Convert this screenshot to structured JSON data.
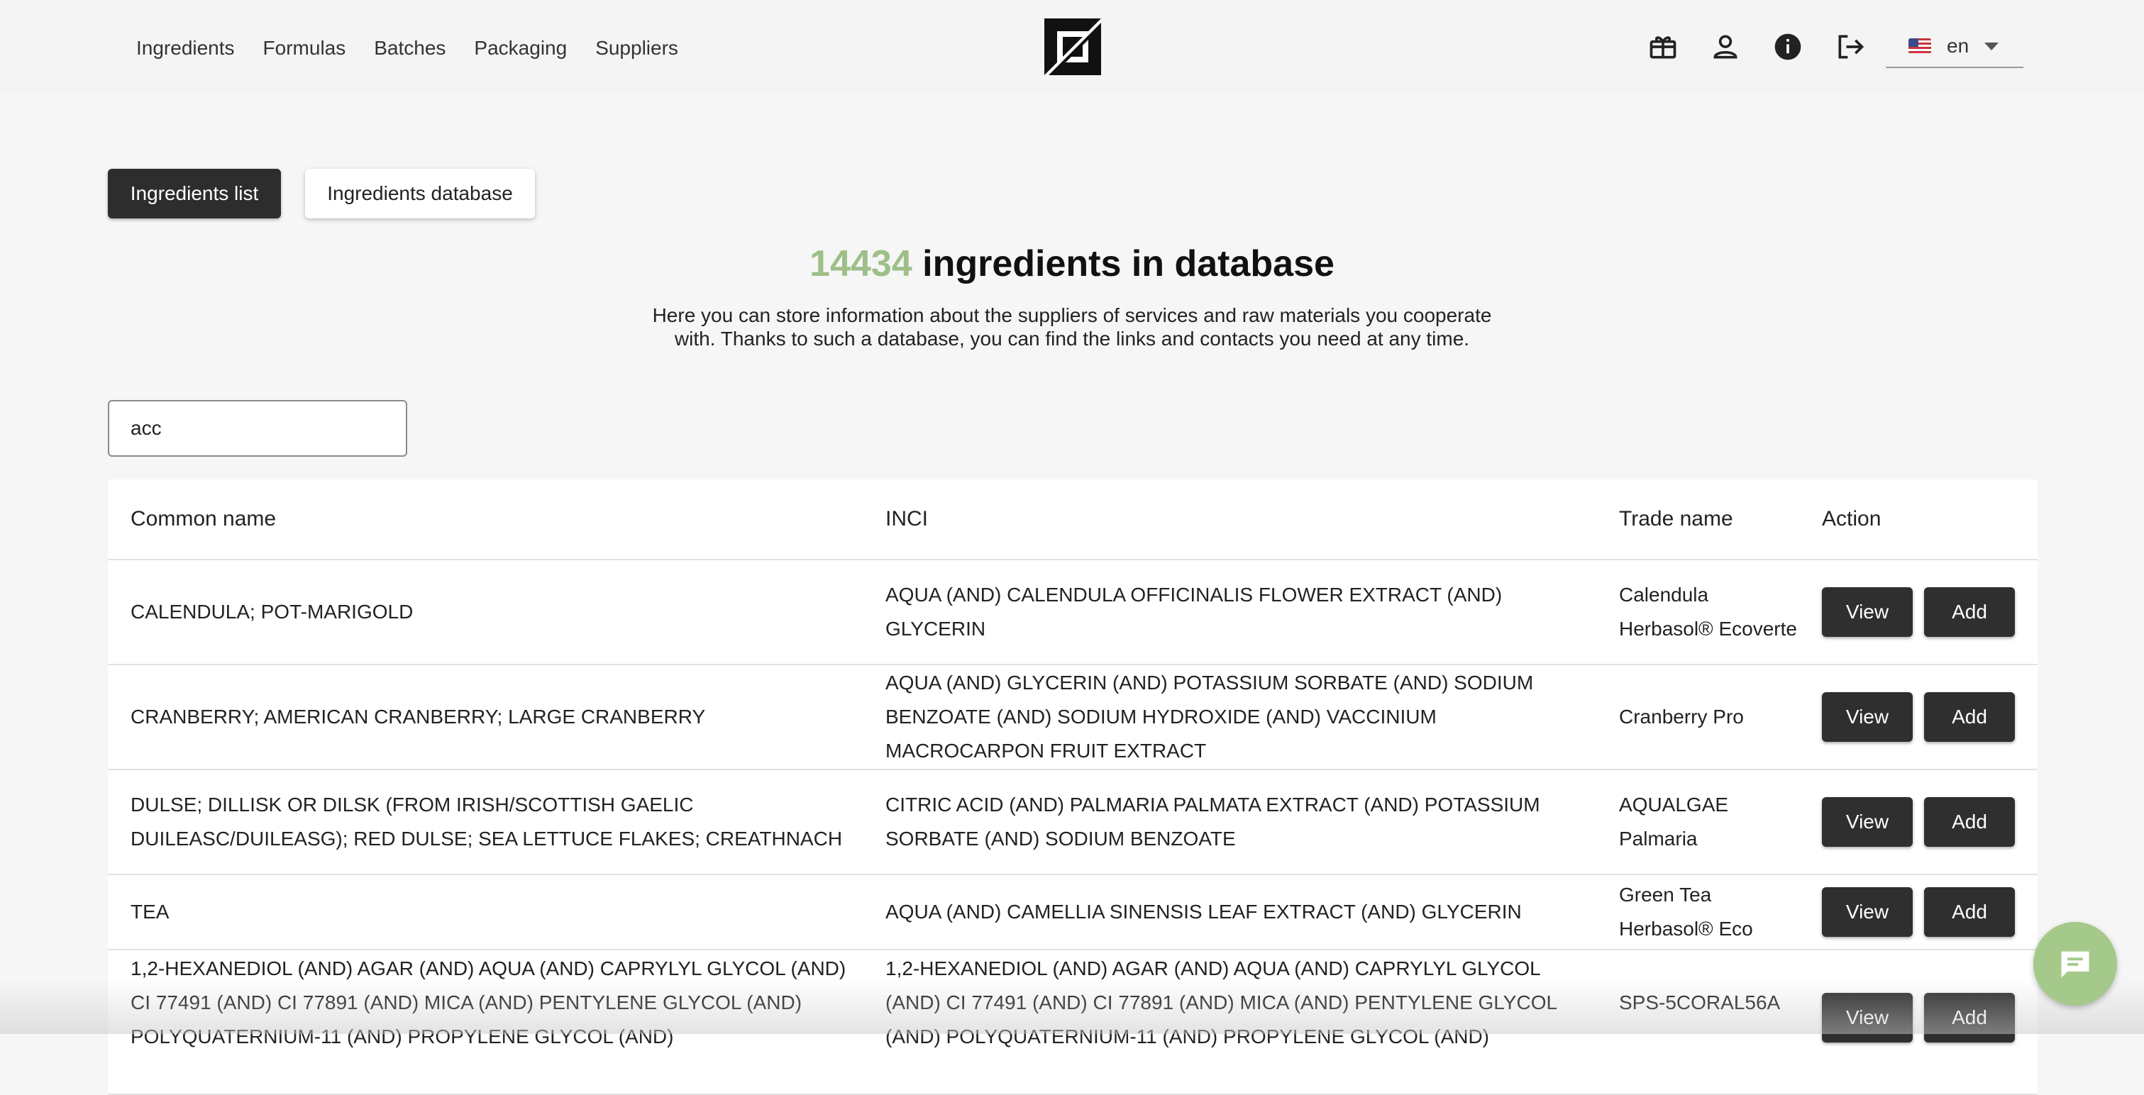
{
  "nav": {
    "items": [
      "Ingredients",
      "Formulas",
      "Batches",
      "Packaging",
      "Suppliers"
    ]
  },
  "header_icons": [
    "gift-box-icon",
    "user-icon",
    "info-icon",
    "logout-icon"
  ],
  "language": {
    "code": "en",
    "flag": "us-flag"
  },
  "tabs": {
    "list": "Ingredients list",
    "database": "Ingredients database"
  },
  "hero": {
    "count": "14434",
    "title_rest": "ingredients in database",
    "description": "Here you can store information about the suppliers of services and raw materials you cooperate with. Thanks to such a database, you can find the links and contacts you need at any time."
  },
  "search": {
    "value": "acc"
  },
  "table": {
    "headers": [
      "Common name",
      "INCI",
      "Trade name",
      "Action"
    ],
    "view_label": "View",
    "add_label": "Add",
    "rows": [
      {
        "common": "CALENDULA; POT-MARIGOLD",
        "inci": "AQUA (AND) CALENDULA OFFICINALIS FLOWER EXTRACT (AND) GLYCERIN",
        "trade": "Calendula Herbasol® Ecoverte"
      },
      {
        "common": "CRANBERRY; AMERICAN CRANBERRY; LARGE CRANBERRY",
        "inci": "AQUA (AND) GLYCERIN (AND) POTASSIUM SORBATE (AND) SODIUM BENZOATE (AND) SODIUM HYDROXIDE (AND) VACCINIUM MACROCARPON FRUIT EXTRACT",
        "trade": "Cranberry Pro"
      },
      {
        "common": "DULSE; DILLISK OR DILSK (FROM IRISH/SCOTTISH GAELIC DUILEASC/DUILEASG); RED DULSE; SEA LETTUCE FLAKES; CREATHNACH",
        "inci": "CITRIC ACID (AND) PALMARIA PALMATA EXTRACT (AND) POTASSIUM SORBATE (AND) SODIUM BENZOATE",
        "trade": "AQUALGAE Palmaria"
      },
      {
        "common": "TEA",
        "inci": "AQUA (AND) CAMELLIA SINENSIS LEAF EXTRACT (AND) GLYCERIN",
        "trade": "Green Tea Herbasol® Eco"
      },
      {
        "common": "1,2-HEXANEDIOL (AND) AGAR (AND) AQUA (AND) CAPRYLYL GLYCOL (AND) CI 77491 (AND) CI 77891 (AND) MICA (AND) PENTYLENE GLYCOL (AND) POLYQUATERNIUM-11 (AND) PROPYLENE GLYCOL (AND)",
        "inci": "1,2-HEXANEDIOL (AND) AGAR (AND) AQUA (AND) CAPRYLYL GLYCOL (AND) CI 77491 (AND) CI 77891 (AND) MICA (AND) PENTYLENE GLYCOL (AND) POLYQUATERNIUM-11 (AND) PROPYLENE GLYCOL (AND)",
        "trade": "SPS-5CORAL56A"
      }
    ]
  },
  "colors": {
    "accent": "#9dbf88",
    "dark_button": "#2f2f2f",
    "chat": "#a5c98a"
  }
}
